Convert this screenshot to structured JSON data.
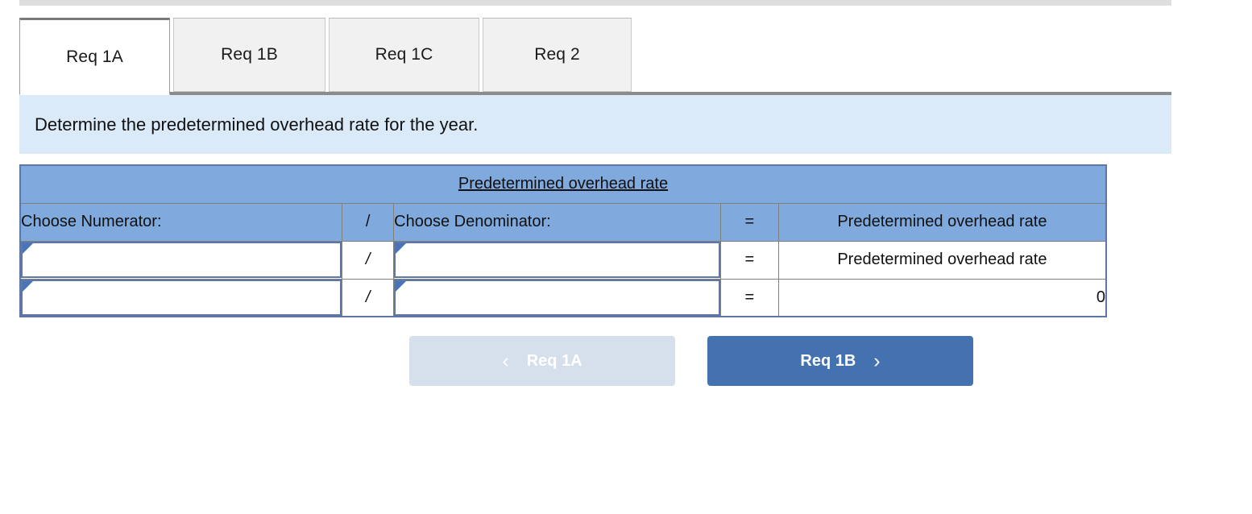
{
  "tabs": [
    {
      "label": "Req 1A",
      "active": true
    },
    {
      "label": "Req 1B",
      "active": false
    },
    {
      "label": "Req 1C",
      "active": false
    },
    {
      "label": "Req 2",
      "active": false
    }
  ],
  "instruction": {
    "text": "Determine the predetermined overhead rate for the year."
  },
  "worksheet": {
    "title": "Predetermined overhead rate",
    "columns": {
      "numerator": "Choose Numerator:",
      "divide": "/",
      "denominator": "Choose Denominator:",
      "equals": "=",
      "result": "Predetermined overhead rate"
    },
    "rows": [
      {
        "numerator_value": "",
        "divide_symbol": "/",
        "denominator_value": "",
        "equals_symbol": "=",
        "result": "Predetermined overhead rate"
      },
      {
        "numerator_value": "",
        "divide_symbol": "/",
        "denominator_value": "",
        "equals_symbol": "=",
        "result": "0"
      }
    ]
  },
  "navigation": {
    "prev_label": "Req 1A",
    "prev_icon": "chevron-left-icon",
    "prev_chevron": "‹",
    "next_label": "Req 1B",
    "next_icon": "chevron-right-icon",
    "next_chevron": "›"
  },
  "colors": {
    "header_blue": "#80a9dd",
    "banner_blue": "#dbeaf8",
    "primary_button": "#4472b0",
    "disabled_button": "#d6e0ec",
    "cell_border_blue": "#5c77a8"
  }
}
